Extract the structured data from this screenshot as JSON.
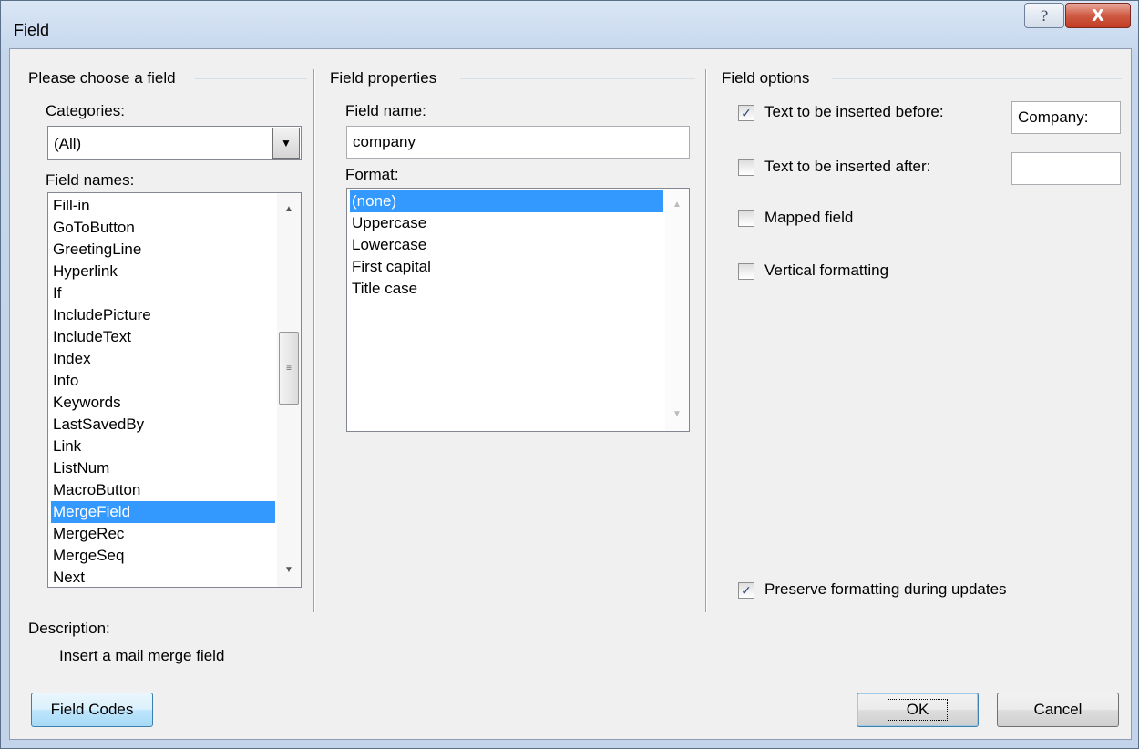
{
  "window": {
    "title": "Field"
  },
  "icons": {
    "help": "help-question-icon",
    "close": "close-x-icon",
    "dropdown": "chevron-down-icon"
  },
  "left_group": {
    "title": "Please choose a field",
    "categories_label": "Categories:",
    "categories_value": "(All)",
    "field_names_label": "Field names:",
    "field_names": [
      "Fill-in",
      "GoToButton",
      "GreetingLine",
      "Hyperlink",
      "If",
      "IncludePicture",
      "IncludeText",
      "Index",
      "Info",
      "Keywords",
      "LastSavedBy",
      "Link",
      "ListNum",
      "MacroButton",
      "MergeField",
      "MergeRec",
      "MergeSeq",
      "Next"
    ],
    "selected_field": "MergeField"
  },
  "middle_group": {
    "title": "Field properties",
    "field_name_label": "Field name:",
    "field_name_value": "company",
    "format_label": "Format:",
    "formats": [
      "(none)",
      "Uppercase",
      "Lowercase",
      "First capital",
      "Title case"
    ],
    "selected_format": "(none)"
  },
  "right_group": {
    "title": "Field options",
    "options": [
      {
        "label": "Text to be inserted before:",
        "checked": true,
        "value": "Company:"
      },
      {
        "label": "Text to be inserted after:",
        "checked": false,
        "value": ""
      },
      {
        "label": "Mapped field",
        "checked": false
      },
      {
        "label": "Vertical formatting",
        "checked": false
      }
    ],
    "preserve_label": "Preserve formatting during updates",
    "preserve_checked": true
  },
  "description": {
    "label": "Description:",
    "text": "Insert a mail merge field"
  },
  "buttons": {
    "field_codes": "Field Codes",
    "ok": "OK",
    "cancel": "Cancel"
  },
  "glyphs": {
    "help": "?",
    "close": "X",
    "check": "✓",
    "arrow_up": "▲",
    "arrow_down": "▼",
    "grip": "≡"
  }
}
